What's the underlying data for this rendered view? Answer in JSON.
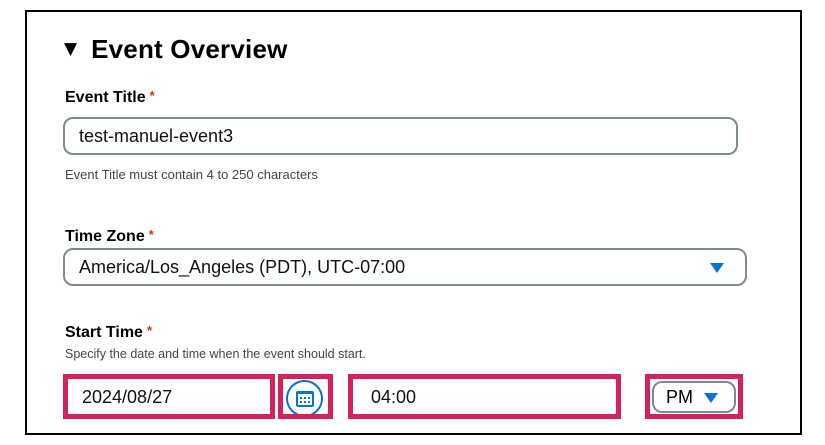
{
  "section": {
    "title": "Event Overview",
    "caret_icon": "triangle-down-icon"
  },
  "event_title": {
    "label": "Event Title",
    "required_mark": "*",
    "value": "test-manuel-event3",
    "hint": "Event Title must contain 4 to 250 characters"
  },
  "time_zone": {
    "label": "Time Zone",
    "required_mark": "*",
    "selected": "America/Los_Angeles (PDT), UTC-07:00"
  },
  "start_time": {
    "label": "Start Time",
    "required_mark": "*",
    "hint": "Specify the date and time when the event should start.",
    "date": "2024/08/27",
    "calendar_icon": "calendar-icon",
    "time": "04:00",
    "ampm": "PM"
  },
  "colors": {
    "highlight": "#d3235a",
    "accent": "#0972d3",
    "required": "#d13212",
    "input_border": "#7d8998"
  }
}
